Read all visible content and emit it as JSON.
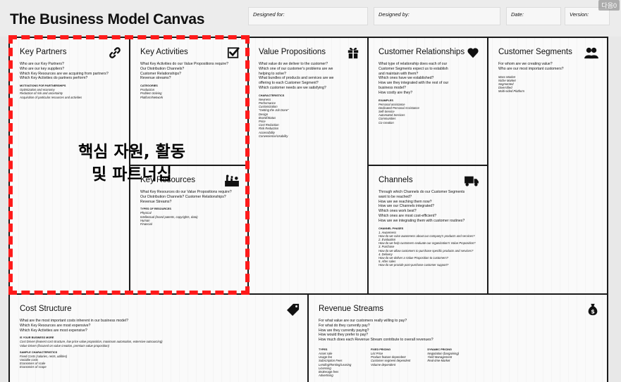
{
  "title": "The Business Model Canvas",
  "header": {
    "designed_for": "Designed for:",
    "designed_by": "Designed by:",
    "date": "Date:",
    "version": "Version:"
  },
  "corner_badge": "다음0",
  "overlay": {
    "line1": "핵심 자원, 활동",
    "line2": "및 파트너십",
    "color": "#ff1a1a"
  },
  "blocks": {
    "key_partners": {
      "title": "Key Partners",
      "icon": "link-icon",
      "questions": [
        "Who are our Key Partners?",
        "Who are our key suppliers?",
        "Which Key Resources are we acquiring from partners?",
        "Which Key Activities do partners perform?"
      ],
      "sub_title": "MOTIVATIONS FOR PARTNERSHIPS",
      "items": [
        "Optimization and economy",
        "Reduction of risk and uncertainty",
        "Acquisition of particular resources and activities"
      ]
    },
    "key_activities": {
      "title": "Key Activities",
      "icon": "checkbox-icon",
      "questions": [
        "What Key Activities do our Value Propositions require?",
        "Our Distribution Channels?",
        "Customer Relationships?",
        "Revenue streams?"
      ],
      "sub_title": "CATEGORIES",
      "items": [
        "Production",
        "Problem Solving",
        "Platform/Network"
      ]
    },
    "key_resources": {
      "title": "Key Resources",
      "icon": "factory-icon",
      "questions": [
        "What Key Resources do our Value Propositions require?",
        "Our Distribution Channels? Customer Relationships?",
        "Revenue Streams?"
      ],
      "sub_title": "TYPES OF RESOURCES",
      "items": [
        "Physical",
        "Intellectual (brand patents, copyrights, data)",
        "Human",
        "Financial"
      ]
    },
    "value_propositions": {
      "title": "Value Propositions",
      "icon": "gift-icon",
      "questions": [
        "What value do we deliver to the customer?",
        "Which one of our customer's problems are we",
        "helping to solve?",
        "What bundles of products and services are we",
        "offering to each Customer Segment?",
        "Which customer needs are we satisfying?"
      ],
      "sub_title": "CHARACTERISTICS",
      "items": [
        "Newness",
        "Performance",
        "Customization",
        "\"Getting the Job Done\"",
        "Design",
        "Brand/Status",
        "Price",
        "Cost Reduction",
        "Risk Reduction",
        "Accessibility",
        "Convenience/Usability"
      ]
    },
    "customer_relationships": {
      "title": "Customer Relationships",
      "icon": "heart-icon",
      "questions": [
        "What type of relationship does each of our",
        "Customer Segments expect us to establish",
        "and maintain with them?",
        "Which ones have we established?",
        "How are they integrated with the rest of our",
        "business model?",
        "How costly are they?"
      ],
      "sub_title": "EXAMPLES",
      "items": [
        "Personal assistance",
        "Dedicated Personal Assistance",
        "Self-Service",
        "Automated Services",
        "Communities",
        "Co-creation"
      ]
    },
    "customer_segments": {
      "title": "Customer Segments",
      "icon": "people-icon",
      "questions": [
        "For whom are we creating value?",
        "Who are our most important customers?"
      ],
      "sub_title": "",
      "items": [
        "Mass Market",
        "Niche Market",
        "Segmented",
        "Diversified",
        "Multi-sided Platform"
      ]
    },
    "channels": {
      "title": "Channels",
      "icon": "truck-icon",
      "questions": [
        "Through which Channels do our Customer Segments",
        "want to be reached?",
        "How are we reaching them now?",
        "How are our Channels integrated?",
        "Which ones work best?",
        "Which ones are most cost-efficient?",
        "How are we integrating them with customer routines?"
      ],
      "sub_title": "CHANNEL PHASES",
      "items": [
        "1. Awareness",
        "How do we raise awareness about our company's products and services?",
        "2. Evaluation",
        "How do we help customers evaluate our organization's Value Proposition?",
        "3. Purchase",
        "How do we allow customers to purchase specific products and services?",
        "4. Delivery",
        "How do we deliver a Value Proposition to customers?",
        "5. After sales",
        "How do we provide post-purchase customer support?"
      ]
    },
    "cost_structure": {
      "title": "Cost Structure",
      "icon": "tag-icon",
      "questions": [
        "What are the most important costs inherent in our business model?",
        "Which Key Resources are most expensive?",
        "Which Key Activities are most expensive?"
      ],
      "sub_title": "IS YOUR BUSINESS MORE",
      "items": [
        "Cost Driven (leanest cost structure, low price value proposition, maximum automation, extensive outsourcing)",
        "Value Driven (focused on value creation, premium value proposition)"
      ],
      "sub_title_2": "SAMPLE CHARACTERISTICS",
      "items_2": [
        "Fixed Costs (salaries, rents, utilities)",
        "Variable costs",
        "Economies of scale",
        "Economies of scope"
      ]
    },
    "revenue_streams": {
      "title": "Revenue Streams",
      "icon": "money-bag-icon",
      "questions": [
        "For what value are our customers really willing to pay?",
        "For what do they currently pay?",
        "How are they currently paying?",
        "How would they prefer to pay?",
        "How much does each Revenue Stream contribute to overall revenues?"
      ],
      "columns": [
        {
          "heading": "TYPES",
          "items": [
            "Asset sale",
            "Usage fee",
            "Subscription Fees",
            "Lending/Renting/Leasing",
            "Licensing",
            "Brokerage fees",
            "Advertising"
          ]
        },
        {
          "heading": "FIXED PRICING",
          "items": [
            "List Price",
            "Product feature dependent",
            "Customer segment dependent",
            "Volume dependent"
          ]
        },
        {
          "heading": "DYNAMIC PRICING",
          "items": [
            "Negotiation (bargaining)",
            "Yield Management",
            "Real-time-Market"
          ]
        }
      ]
    }
  }
}
